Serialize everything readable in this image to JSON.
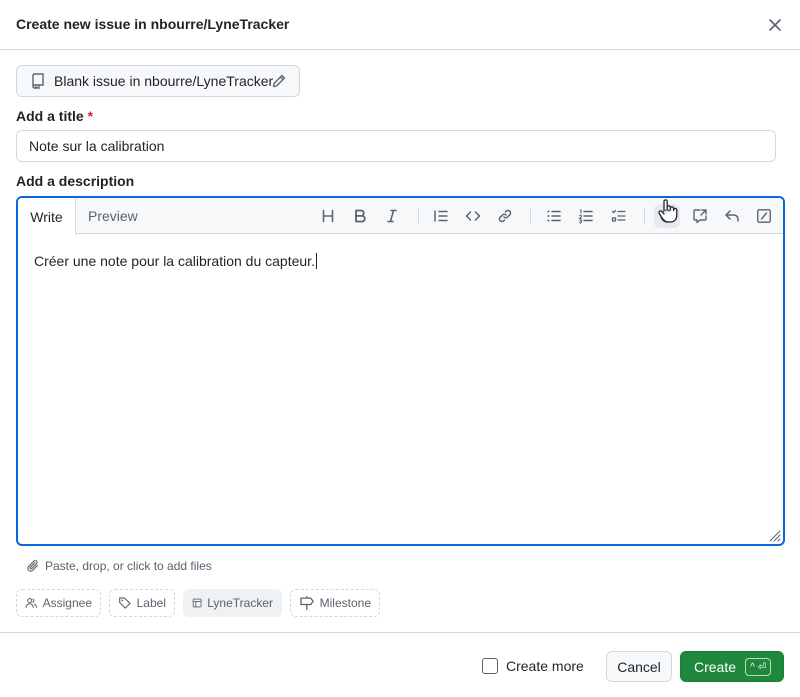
{
  "dialog": {
    "title": "Create new issue in nbourre/LyneTracker",
    "close_icon": "x-icon"
  },
  "template": {
    "label": "Blank issue in nbourre/LyneTracker",
    "icon": "repo-icon",
    "edit_icon": "pencil-icon"
  },
  "title_field": {
    "label": "Add a title",
    "required_marker": "*",
    "value": "Note sur la calibration"
  },
  "description": {
    "label": "Add a description",
    "tabs": [
      {
        "label": "Write",
        "active": true
      },
      {
        "label": "Preview",
        "active": false
      }
    ],
    "toolbar": [
      "heading-icon",
      "bold-icon",
      "italic-icon",
      "quote-icon",
      "code-icon",
      "link-icon",
      "bulleted-list-icon",
      "numbered-list-icon",
      "task-list-icon",
      "mention-icon",
      "reference-icon",
      "undo-icon",
      "slash-command-icon"
    ],
    "text": "Créer une note pour la calibration du capteur.",
    "attach_hint": "Paste, drop, or click to add files"
  },
  "metadata": {
    "assignee": "Assignee",
    "label": "Label",
    "project": "LyneTracker",
    "milestone": "Milestone"
  },
  "footer": {
    "create_more": "Create more",
    "create_more_checked": false,
    "cancel": "Cancel",
    "create": "Create",
    "shortcut": "^ ⏎"
  },
  "colors": {
    "accent": "#0969da",
    "primary_button": "#1f883d",
    "required": "#d1242f"
  }
}
